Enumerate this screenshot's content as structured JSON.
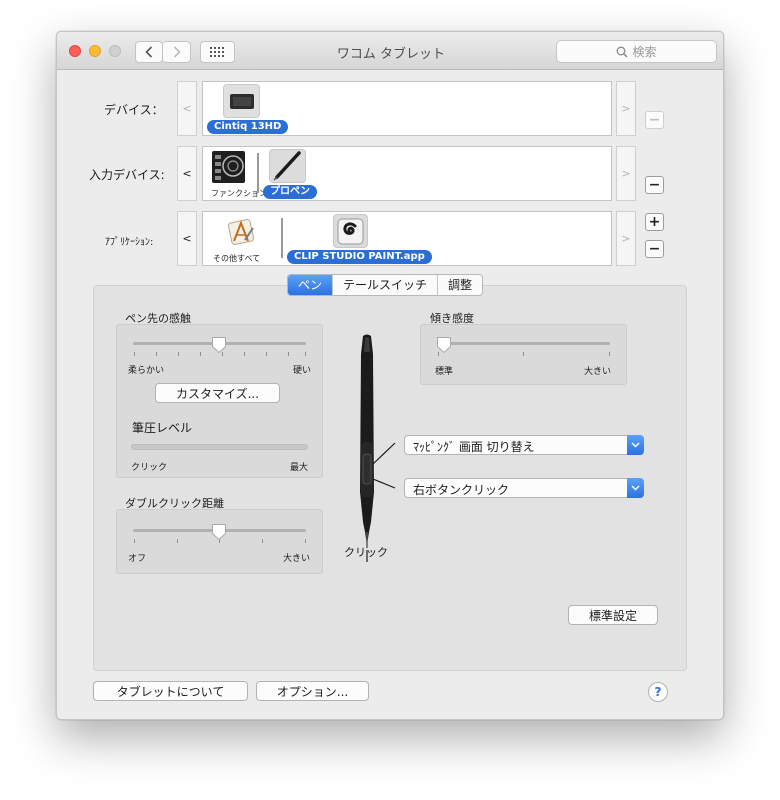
{
  "window": {
    "title": "ワコム タブレット"
  },
  "search": {
    "placeholder": "検索"
  },
  "rows": {
    "device": {
      "label": "デバイス：",
      "items": [
        {
          "tag": "Cintiq 13HD"
        }
      ]
    },
    "input": {
      "label": "入力デバイス:",
      "items": [
        {
          "caption": "ファンクション"
        },
        {
          "tag": "プロペン"
        }
      ]
    },
    "app": {
      "label": "ｱﾌﾟﾘｹｰｼｮﾝ:",
      "items": [
        {
          "caption": "その他すべて"
        },
        {
          "tag": "CLIP STUDIO PAINT.app"
        }
      ]
    },
    "scroll_left": "<",
    "scroll_right": ">",
    "add": "+",
    "remove": "−"
  },
  "tabs": [
    {
      "label": "ペン"
    },
    {
      "label": "テールスイッチ"
    },
    {
      "label": "調整"
    }
  ],
  "pen": {
    "tip_feel": {
      "title": "ペン先の感触",
      "min_label": "柔らかい",
      "max_label": "硬い",
      "value": 0.5
    },
    "customize_button": "カスタマイズ...",
    "pressure": {
      "title": "筆圧レベル",
      "min_label": "クリック",
      "max_label": "最大"
    },
    "double_click": {
      "title": "ダブルクリック距離",
      "min_label": "オフ",
      "max_label": "大きい",
      "value": 0.5
    },
    "tilt": {
      "title": "傾き感度",
      "min_label": "標準",
      "max_label": "大きい",
      "value": 0.0
    },
    "upper_button": "ﾏｯﾋﾟﾝｸﾞ 画面 切り替え",
    "lower_button": "右ボタンクリック",
    "tip_label": "クリック",
    "default_button": "標準設定"
  },
  "footer": {
    "about_button": "タブレットについて",
    "options_button": "オプション...",
    "help": "?"
  },
  "colors": {
    "accent": "#2a72df",
    "window": "#ececec",
    "panel": "#e2e2e2"
  }
}
